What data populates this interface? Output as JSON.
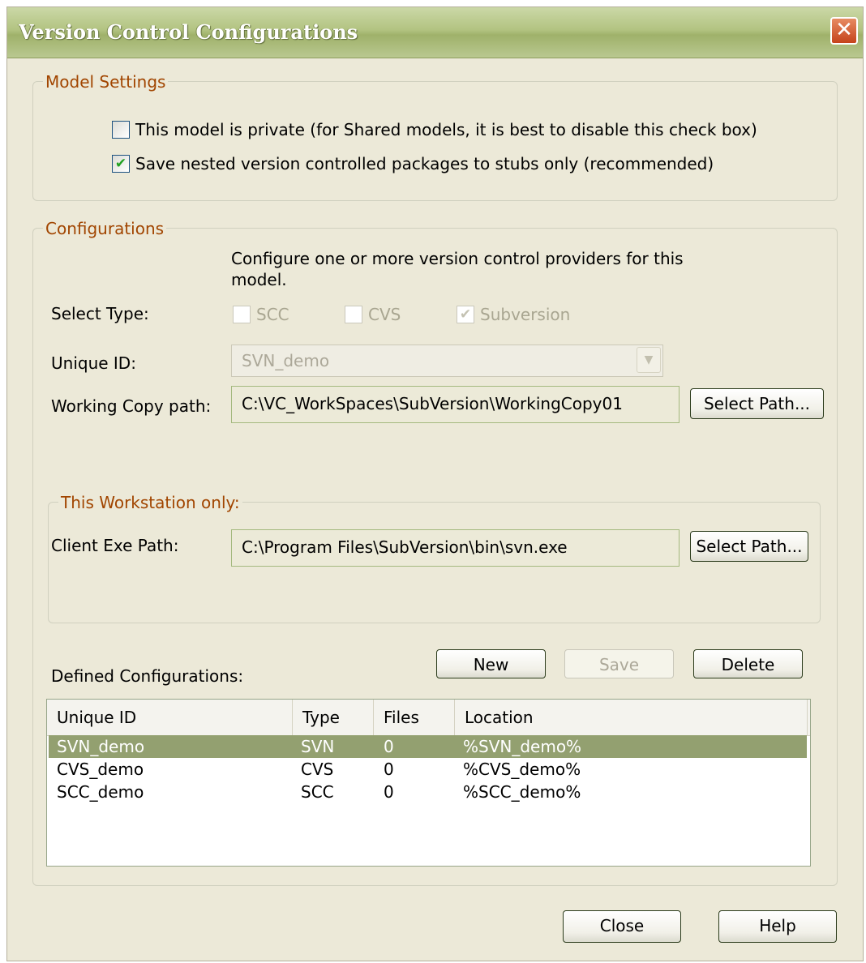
{
  "window": {
    "title": "Version Control Configurations"
  },
  "model_settings": {
    "title": "Model Settings",
    "private_label": "This model is private (for Shared models, it is best to disable this check box)",
    "private_checked": false,
    "stubs_label": "Save nested version controlled packages to stubs only (recommended)",
    "stubs_checked": true
  },
  "configurations": {
    "title": "Configurations",
    "description_line1": "Configure one or more version control providers for this",
    "description_line2": "model.",
    "select_type_label": "Select Type:",
    "types": [
      {
        "label": "SCC",
        "checked": false
      },
      {
        "label": "CVS",
        "checked": false
      },
      {
        "label": "Subversion",
        "checked": true
      }
    ],
    "unique_id_label": "Unique ID:",
    "unique_id_value": "SVN_demo",
    "working_copy_label": "Working Copy path:",
    "working_copy_value": "C:\\VC_WorkSpaces\\SubVersion\\WorkingCopy01",
    "select_path_label": "Select Path..."
  },
  "workstation": {
    "title": "This Workstation only:",
    "client_exe_label": "Client Exe Path:",
    "client_exe_value": "C:\\Program Files\\SubVersion\\bin\\svn.exe",
    "select_path_label": "Select Path..."
  },
  "defined": {
    "label": "Defined Configurations:",
    "new_label": "New",
    "save_label": "Save",
    "delete_label": "Delete",
    "columns": [
      "Unique ID",
      "Type",
      "Files",
      "Location"
    ],
    "rows": [
      {
        "id": "SVN_demo",
        "type": "SVN",
        "files": "0",
        "location": "%SVN_demo%",
        "selected": true
      },
      {
        "id": "CVS_demo",
        "type": "CVS",
        "files": "0",
        "location": "%CVS_demo%",
        "selected": false
      },
      {
        "id": "SCC_demo",
        "type": "SCC",
        "files": "0",
        "location": "%SCC_demo%",
        "selected": false
      }
    ]
  },
  "footer": {
    "close_label": "Close",
    "help_label": "Help"
  },
  "colors": {
    "title_bar": "#b2c381",
    "group_title": "#a14500",
    "selection": "#93a070",
    "close_button": "#c5431b"
  }
}
